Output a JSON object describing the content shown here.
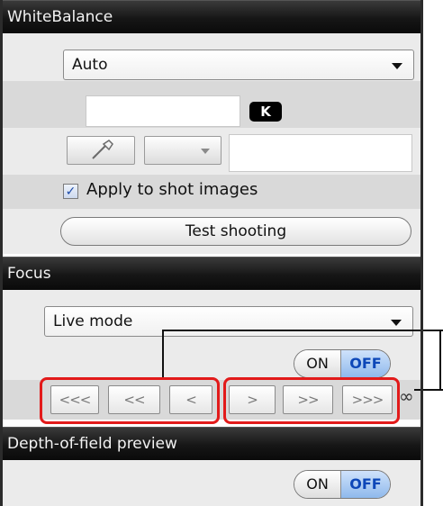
{
  "white_balance": {
    "header": "WhiteBalance",
    "mode_value": "Auto",
    "kelvin_value": "",
    "kelvin_badge": "K",
    "preset_value": "",
    "apply_checked": true,
    "apply_label": "Apply to shot images",
    "test_button": "Test shooting"
  },
  "focus": {
    "header": "Focus",
    "mode_value": "Live mode",
    "toggle_on": "ON",
    "toggle_off": "OFF",
    "toggle_selected": "OFF",
    "near_buttons": [
      "<<<",
      "<<",
      "<"
    ],
    "far_buttons": [
      ">",
      ">>",
      ">>>"
    ],
    "infinity_symbol": "∞"
  },
  "dof": {
    "header": "Depth-of-field preview",
    "toggle_on": "ON",
    "toggle_off": "OFF",
    "toggle_selected": "OFF"
  },
  "colors": {
    "header_bg": "#161616",
    "selected_toggle": "#8fb9ec",
    "highlight_red": "#e21a1a"
  }
}
